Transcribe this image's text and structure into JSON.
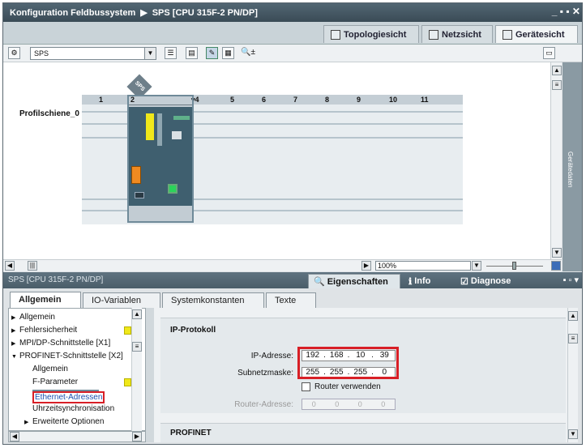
{
  "titlebar": {
    "project": "Konfiguration Feldbussystem",
    "arrow": "▶",
    "device": "SPS [CPU 315F-2 PN/DP]",
    "controls": "_ ▪ ▪ ✕"
  },
  "view_tabs": [
    {
      "label": "Topologiesicht",
      "active": false
    },
    {
      "label": "Netzsicht",
      "active": false
    },
    {
      "label": "Gerätesicht",
      "active": true
    }
  ],
  "toolbar": {
    "device_select": "SPS",
    "zoom_icon": "🔍±"
  },
  "canvas": {
    "device_label": "SPS",
    "rack_name": "Profilschiene_0",
    "slots": [
      "1",
      "2",
      "▾4",
      "5",
      "6",
      "7",
      "8",
      "9",
      "10",
      "11"
    ]
  },
  "side_task": {
    "label": "Gerätedaten"
  },
  "zoom": {
    "value": "100%"
  },
  "inspector": {
    "title": "SPS [CPU 315F-2 PN/DP]",
    "tabs": [
      {
        "label": "Eigenschaften",
        "active": true
      },
      {
        "label": "Info",
        "active": false
      },
      {
        "label": "Diagnose",
        "active": false
      }
    ],
    "prop_tabs": [
      {
        "label": "Allgemein",
        "active": true
      },
      {
        "label": "IO-Variablen",
        "active": false
      },
      {
        "label": "Systemkonstanten",
        "active": false
      },
      {
        "label": "Texte",
        "active": false
      }
    ],
    "tree": [
      {
        "label": "Allgemein",
        "tri": "▶",
        "indent": 0
      },
      {
        "label": "Fehlersicherheit",
        "tri": "▶",
        "indent": 0
      },
      {
        "label": "MPI/DP-Schnittstelle [X1]",
        "tri": "▶",
        "indent": 0
      },
      {
        "label": "PROFINET-Schnittstelle [X2]",
        "tri": "▼",
        "indent": 0
      },
      {
        "label": "Allgemein",
        "tri": "",
        "indent": 1
      },
      {
        "label": "F-Parameter",
        "tri": "",
        "indent": 1
      },
      {
        "label": "Ethernet-Adressen",
        "tri": "",
        "indent": 1,
        "selected": true
      },
      {
        "label": "Uhrzeitsynchronisation",
        "tri": "",
        "indent": 1
      },
      {
        "label": "Erweiterte Optionen",
        "tri": "▶",
        "indent": 1
      }
    ],
    "ip_section": {
      "heading": "IP-Protokoll",
      "ip_label": "IP-Adresse:",
      "ip": [
        "192",
        "168",
        "10",
        "39"
      ],
      "mask_label": "Subnetzmaske:",
      "mask": [
        "255",
        "255",
        "255",
        "0"
      ],
      "router_use_label": "Router verwenden",
      "router_label": "Router-Adresse:",
      "router": [
        "0",
        "0",
        "0",
        "0"
      ]
    },
    "profinet_heading": "PROFINET"
  },
  "colors": {
    "highlight": "#d81f26",
    "status_yellow": "#f0e81a",
    "titlebar": "#3a4b56"
  }
}
